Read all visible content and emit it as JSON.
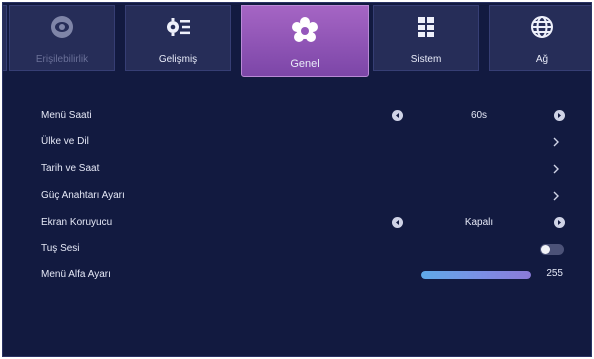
{
  "tabs": [
    {
      "label": "Erişilebilirlik",
      "icon": "eye-icon",
      "active": false,
      "dim": true
    },
    {
      "label": "Gelişmiş",
      "icon": "advanced-settings-icon",
      "active": false
    },
    {
      "label": "Genel",
      "icon": "gear-flower-icon",
      "active": true
    },
    {
      "label": "Sistem",
      "icon": "system-grid-icon",
      "active": false
    },
    {
      "label": "Ağ",
      "icon": "globe-icon",
      "active": false
    }
  ],
  "menu": {
    "menu_time": {
      "label": "Menü Saati",
      "value": "60s"
    },
    "country_language": {
      "label": "Ülke ve Dil"
    },
    "date_time": {
      "label": "Tarih ve Saat"
    },
    "power_switch": {
      "label": "Güç Anahtarı Ayarı"
    },
    "screensaver": {
      "label": "Ekran Koruyucu",
      "value": "Kapalı"
    },
    "key_sound": {
      "label": "Tuş Sesi",
      "toggle_on": false
    },
    "menu_alpha": {
      "label": "Menü Alfa Ayarı",
      "value": "255",
      "level_fraction": 1.0
    }
  },
  "colors": {
    "background": "#121a40",
    "tab_bg": "#262d58",
    "active_tab": "#9a5bbf",
    "text": "#e6e9f7"
  }
}
